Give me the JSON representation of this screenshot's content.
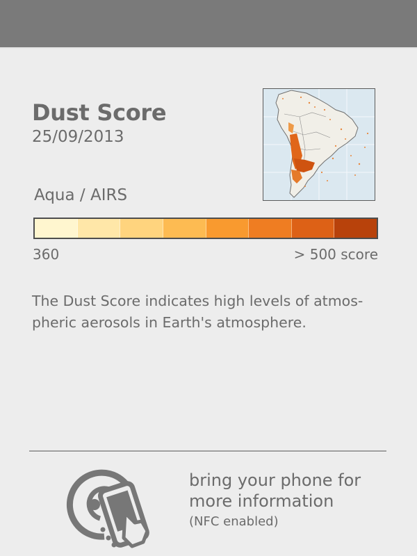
{
  "header": {
    "title": "Dust Score",
    "date": "25/09/2013"
  },
  "map": {
    "region": "South America",
    "icon": "map-thumbnail"
  },
  "instrument": "Aqua / AIRS",
  "scale": {
    "min_label": "360",
    "max_label": "> 500 score",
    "colors": [
      "#fff6cf",
      "#ffe7a8",
      "#ffd47e",
      "#fdbb52",
      "#f99a2f",
      "#ef7d22",
      "#dd6116",
      "#b8420b"
    ]
  },
  "description": "The Dust Score indicates high levels of atmos-\npheric aerosols in Earth's atmosphere.",
  "nfc": {
    "line1": "bring your phone for",
    "line2": "more information",
    "sub": "(NFC enabled)",
    "icon": "nfc-phone-icon"
  }
}
